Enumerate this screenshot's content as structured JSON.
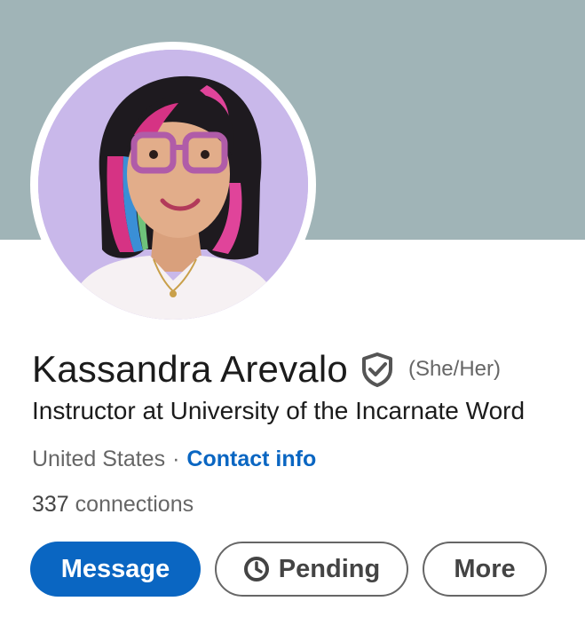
{
  "profile": {
    "name": "Kassandra Arevalo",
    "pronouns": "(She/Her)",
    "headline": "Instructor at University of the Incarnate Word",
    "location": "United States",
    "separator": "·",
    "contact_label": "Contact info",
    "connections_count": "337",
    "connections_label": "connections"
  },
  "actions": {
    "message_label": "Message",
    "pending_label": "Pending",
    "more_label": "More"
  },
  "colors": {
    "cover": "#a0b4b7",
    "primary": "#0a66c2",
    "avatar_background": "#c9b8ea"
  },
  "icons": {
    "verified": "shield-check-icon",
    "pending": "clock-icon"
  }
}
